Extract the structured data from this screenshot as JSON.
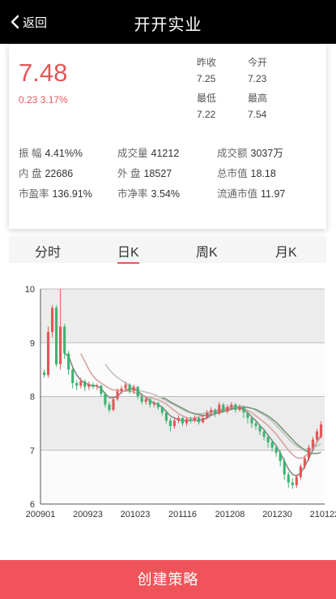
{
  "header": {
    "back_label": "返回",
    "title": "开开实业"
  },
  "quote": {
    "price": "7.48",
    "change": "0.23 3.17%",
    "prev_close_label": "昨收",
    "prev_close": "7.25",
    "open_label": "今开",
    "open": "7.23",
    "low_label": "最低",
    "low": "7.22",
    "high_label": "最高",
    "high": "7.54",
    "stats": [
      {
        "label": "振 幅",
        "value": "4.41%%"
      },
      {
        "label": "成交量",
        "value": "41212"
      },
      {
        "label": "成交额",
        "value": "3037万"
      },
      {
        "label": "内 盘",
        "value": "22686"
      },
      {
        "label": "外 盘",
        "value": "18527"
      },
      {
        "label": "总市值",
        "value": "18.18"
      },
      {
        "label": "市盈率",
        "value": "136.91%"
      },
      {
        "label": "市净率",
        "value": "3.54%"
      },
      {
        "label": "流通市值",
        "value": "11.97"
      }
    ]
  },
  "tabs": [
    "分时",
    "日K",
    "周K",
    "月K"
  ],
  "active_tab": "日K",
  "colors": {
    "up": "#e0585a",
    "down": "#3cb371",
    "accent": "#f0545a"
  },
  "chart_data": {
    "type": "candlestick",
    "x_ticks": [
      "200901",
      "200923",
      "201023",
      "201116",
      "201208",
      "201230",
      "210122"
    ],
    "y_ticks": [
      "6",
      "7",
      "8",
      "9",
      "10"
    ],
    "ylim": [
      6,
      10
    ],
    "candles": [
      {
        "o": 8.45,
        "c": 8.4,
        "h": 8.5,
        "l": 8.35
      },
      {
        "o": 8.4,
        "c": 9.2,
        "h": 9.3,
        "l": 8.35
      },
      {
        "o": 9.2,
        "c": 9.65,
        "h": 9.7,
        "l": 9.1
      },
      {
        "o": 9.65,
        "c": 8.6,
        "h": 9.7,
        "l": 8.55
      },
      {
        "o": 8.6,
        "c": 9.3,
        "h": 10.0,
        "l": 8.5
      },
      {
        "o": 9.3,
        "c": 8.8,
        "h": 9.35,
        "l": 8.7
      },
      {
        "o": 8.8,
        "c": 8.5,
        "h": 8.85,
        "l": 8.4
      },
      {
        "o": 8.5,
        "c": 8.25,
        "h": 8.55,
        "l": 8.15
      },
      {
        "o": 8.25,
        "c": 8.2,
        "h": 8.3,
        "l": 8.12
      },
      {
        "o": 8.2,
        "c": 8.28,
        "h": 8.35,
        "l": 8.15
      },
      {
        "o": 8.28,
        "c": 8.18,
        "h": 8.32,
        "l": 8.1
      },
      {
        "o": 8.18,
        "c": 8.22,
        "h": 8.28,
        "l": 8.12
      },
      {
        "o": 8.22,
        "c": 8.18,
        "h": 8.26,
        "l": 8.14
      },
      {
        "o": 8.18,
        "c": 8.2,
        "h": 8.24,
        "l": 8.12
      },
      {
        "o": 8.2,
        "c": 8.05,
        "h": 8.22,
        "l": 8.0
      },
      {
        "o": 8.05,
        "c": 7.85,
        "h": 8.08,
        "l": 7.8
      },
      {
        "o": 7.85,
        "c": 7.75,
        "h": 7.9,
        "l": 7.7
      },
      {
        "o": 7.75,
        "c": 7.95,
        "h": 8.0,
        "l": 7.72
      },
      {
        "o": 7.95,
        "c": 8.1,
        "h": 8.15,
        "l": 7.92
      },
      {
        "o": 8.1,
        "c": 8.15,
        "h": 8.2,
        "l": 8.05
      },
      {
        "o": 8.15,
        "c": 8.22,
        "h": 8.28,
        "l": 8.1
      },
      {
        "o": 8.22,
        "c": 8.1,
        "h": 8.25,
        "l": 8.05
      },
      {
        "o": 8.1,
        "c": 8.18,
        "h": 8.22,
        "l": 8.05
      },
      {
        "o": 8.18,
        "c": 8.0,
        "h": 8.2,
        "l": 7.95
      },
      {
        "o": 8.0,
        "c": 7.9,
        "h": 8.05,
        "l": 7.85
      },
      {
        "o": 7.9,
        "c": 7.95,
        "h": 8.0,
        "l": 7.85
      },
      {
        "o": 7.95,
        "c": 7.85,
        "h": 7.98,
        "l": 7.8
      },
      {
        "o": 7.85,
        "c": 7.88,
        "h": 7.92,
        "l": 7.8
      },
      {
        "o": 7.88,
        "c": 7.8,
        "h": 7.9,
        "l": 7.75
      },
      {
        "o": 7.8,
        "c": 7.7,
        "h": 7.82,
        "l": 7.65
      },
      {
        "o": 7.7,
        "c": 7.55,
        "h": 7.72,
        "l": 7.5
      },
      {
        "o": 7.55,
        "c": 7.45,
        "h": 7.6,
        "l": 7.35
      },
      {
        "o": 7.45,
        "c": 7.55,
        "h": 7.6,
        "l": 7.4
      },
      {
        "o": 7.55,
        "c": 7.6,
        "h": 7.65,
        "l": 7.5
      },
      {
        "o": 7.6,
        "c": 7.5,
        "h": 7.62,
        "l": 7.45
      },
      {
        "o": 7.5,
        "c": 7.58,
        "h": 7.62,
        "l": 7.45
      },
      {
        "o": 7.58,
        "c": 7.55,
        "h": 7.62,
        "l": 7.5
      },
      {
        "o": 7.55,
        "c": 7.6,
        "h": 7.65,
        "l": 7.52
      },
      {
        "o": 7.6,
        "c": 7.52,
        "h": 7.62,
        "l": 7.48
      },
      {
        "o": 7.52,
        "c": 7.6,
        "h": 7.65,
        "l": 7.5
      },
      {
        "o": 7.6,
        "c": 7.7,
        "h": 7.75,
        "l": 7.58
      },
      {
        "o": 7.7,
        "c": 7.75,
        "h": 7.8,
        "l": 7.65
      },
      {
        "o": 7.75,
        "c": 7.68,
        "h": 7.78,
        "l": 7.62
      },
      {
        "o": 7.68,
        "c": 7.85,
        "h": 7.9,
        "l": 7.65
      },
      {
        "o": 7.85,
        "c": 7.72,
        "h": 7.88,
        "l": 7.7
      },
      {
        "o": 7.72,
        "c": 7.8,
        "h": 7.85,
        "l": 7.68
      },
      {
        "o": 7.8,
        "c": 7.85,
        "h": 7.9,
        "l": 7.75
      },
      {
        "o": 7.85,
        "c": 7.75,
        "h": 7.88,
        "l": 7.7
      },
      {
        "o": 7.75,
        "c": 7.8,
        "h": 7.85,
        "l": 7.72
      },
      {
        "o": 7.8,
        "c": 7.7,
        "h": 7.82,
        "l": 7.6
      },
      {
        "o": 7.7,
        "c": 7.6,
        "h": 7.72,
        "l": 7.5
      },
      {
        "o": 7.6,
        "c": 7.5,
        "h": 7.62,
        "l": 7.42
      },
      {
        "o": 7.5,
        "c": 7.45,
        "h": 7.55,
        "l": 7.38
      },
      {
        "o": 7.45,
        "c": 7.35,
        "h": 7.48,
        "l": 7.28
      },
      {
        "o": 7.35,
        "c": 7.25,
        "h": 7.4,
        "l": 7.18
      },
      {
        "o": 7.25,
        "c": 7.15,
        "h": 7.3,
        "l": 7.05
      },
      {
        "o": 7.15,
        "c": 7.05,
        "h": 7.2,
        "l": 6.98
      },
      {
        "o": 7.05,
        "c": 6.95,
        "h": 7.1,
        "l": 6.88
      },
      {
        "o": 6.95,
        "c": 6.8,
        "h": 7.0,
        "l": 6.7
      },
      {
        "o": 6.8,
        "c": 6.55,
        "h": 6.85,
        "l": 6.45
      },
      {
        "o": 6.55,
        "c": 6.4,
        "h": 6.6,
        "l": 6.3
      },
      {
        "o": 6.4,
        "c": 6.35,
        "h": 6.48,
        "l": 6.28
      },
      {
        "o": 6.35,
        "c": 6.5,
        "h": 6.55,
        "l": 6.3
      },
      {
        "o": 6.5,
        "c": 6.7,
        "h": 6.75,
        "l": 6.45
      },
      {
        "o": 6.7,
        "c": 6.85,
        "h": 6.9,
        "l": 6.65
      },
      {
        "o": 6.85,
        "c": 7.05,
        "h": 7.1,
        "l": 6.8
      },
      {
        "o": 7.05,
        "c": 7.2,
        "h": 7.25,
        "l": 7.0
      },
      {
        "o": 7.2,
        "c": 7.35,
        "h": 7.4,
        "l": 7.15
      },
      {
        "o": 7.25,
        "c": 7.48,
        "h": 7.54,
        "l": 7.22
      }
    ],
    "ma_series": [
      {
        "color": "#888888",
        "values": [
          null,
          null,
          null,
          null,
          null,
          8.8,
          8.75,
          8.55,
          8.4,
          8.3,
          8.25,
          8.22,
          8.2,
          8.2,
          8.15,
          8.05,
          7.98,
          7.98,
          8.0,
          8.08,
          8.12,
          8.14,
          8.14,
          8.1,
          8.04,
          7.98,
          7.92,
          7.88,
          7.85,
          7.8,
          7.72,
          7.64,
          7.6,
          7.57,
          7.55,
          7.55,
          7.56,
          7.56,
          7.56,
          7.57,
          7.6,
          7.65,
          7.68,
          7.72,
          7.75,
          7.78,
          7.78,
          7.8,
          7.78,
          7.76,
          7.7,
          7.62,
          7.55,
          7.46,
          7.38,
          7.28,
          7.18,
          7.08,
          6.95,
          6.8,
          6.65,
          6.55,
          6.52,
          6.58,
          6.7,
          6.85,
          7.0,
          7.15,
          7.28
        ]
      },
      {
        "color": "#d9a3a3",
        "values": [
          null,
          null,
          null,
          null,
          null,
          null,
          null,
          null,
          null,
          8.8,
          8.65,
          8.5,
          8.38,
          8.3,
          8.25,
          8.2,
          8.15,
          8.12,
          8.12,
          8.1,
          8.1,
          8.1,
          8.08,
          8.05,
          8.02,
          8.0,
          7.98,
          7.96,
          7.94,
          7.9,
          7.86,
          7.8,
          7.74,
          7.68,
          7.64,
          7.6,
          7.6,
          7.6,
          7.62,
          7.64,
          7.66,
          7.7,
          7.72,
          7.74,
          7.76,
          7.78,
          7.8,
          7.8,
          7.8,
          7.78,
          7.74,
          7.7,
          7.64,
          7.58,
          7.52,
          7.46,
          7.38,
          7.3,
          7.2,
          7.1,
          7.0,
          6.92,
          6.86,
          6.85,
          6.88,
          6.95,
          7.05,
          7.15,
          7.25
        ]
      },
      {
        "color": "#c0c0c0",
        "values": [
          null,
          null,
          null,
          null,
          null,
          null,
          null,
          null,
          null,
          null,
          null,
          null,
          null,
          null,
          null,
          8.6,
          8.5,
          8.42,
          8.35,
          8.3,
          8.25,
          8.2,
          8.16,
          8.12,
          8.1,
          8.08,
          8.06,
          8.04,
          8.0,
          7.96,
          7.92,
          7.88,
          7.84,
          7.8,
          7.76,
          7.72,
          7.7,
          7.68,
          7.68,
          7.68,
          7.7,
          7.72,
          7.74,
          7.76,
          7.78,
          7.8,
          7.82,
          7.82,
          7.82,
          7.82,
          7.8,
          7.78,
          7.74,
          7.7,
          7.66,
          7.6,
          7.54,
          7.46,
          7.38,
          7.3,
          7.22,
          7.14,
          7.08,
          7.04,
          7.02,
          7.02,
          7.04,
          7.08,
          7.12
        ]
      },
      {
        "color": "#7a9a7a",
        "values": [
          null,
          null,
          null,
          null,
          null,
          null,
          null,
          null,
          null,
          null,
          null,
          null,
          null,
          null,
          null,
          null,
          null,
          null,
          null,
          null,
          null,
          null,
          null,
          null,
          null,
          null,
          null,
          null,
          null,
          7.98,
          7.95,
          7.9,
          7.86,
          7.82,
          7.78,
          7.74,
          7.7,
          7.68,
          7.66,
          7.65,
          7.65,
          7.66,
          7.68,
          7.7,
          7.72,
          7.74,
          7.76,
          7.78,
          7.8,
          7.8,
          7.8,
          7.78,
          7.76,
          7.72,
          7.68,
          7.64,
          7.58,
          7.52,
          7.44,
          7.36,
          7.28,
          7.2,
          7.12,
          7.06,
          7.0,
          6.96,
          6.94,
          6.94,
          6.96
        ]
      }
    ]
  },
  "create_button": "创建策略"
}
